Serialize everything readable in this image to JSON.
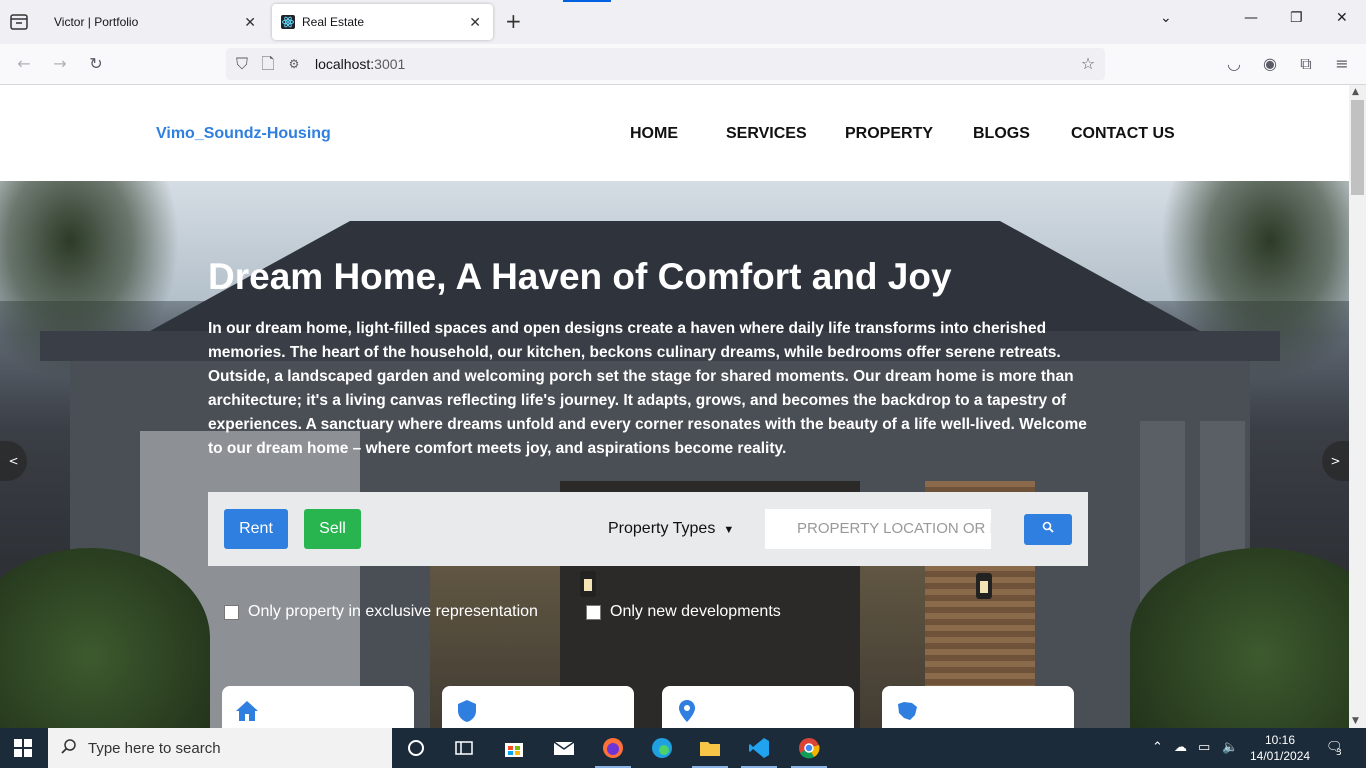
{
  "browser": {
    "tabs": [
      {
        "title": "Victor | Portfolio",
        "active": false
      },
      {
        "title": "Real Estate",
        "active": true
      }
    ],
    "url_host": "localhost:",
    "url_port": "3001"
  },
  "site": {
    "brand": "Vimo_Soundz-Housing",
    "menu": [
      "HOME",
      "SERVICES",
      "PROPERTY",
      "BLOGS",
      "CONTACT US"
    ]
  },
  "hero": {
    "title": "Dream Home, A Haven of Comfort and Joy",
    "text": "In our dream home, light-filled spaces and open designs create a haven where daily life transforms into cherished memories. The heart of the household, our kitchen, beckons culinary dreams, while bedrooms offer serene retreats. Outside, a landscaped garden and welcoming porch set the stage for shared moments. Our dream home is more than architecture; it's a living canvas reflecting life's journey. It adapts, grows, and becomes the backdrop to a tapestry of experiences. A sanctuary where dreams unfold and every corner resonates with the beauty of a life well-lived. Welcome to our dream home – where comfort meets joy, and aspirations become reality.",
    "prev_label": "<",
    "next_label": ">"
  },
  "search": {
    "rent_label": "Rent",
    "sell_label": "Sell",
    "property_types": "Property Types",
    "location_placeholder": "PROPERTY LOCATION OR I"
  },
  "filters": [
    "Only property in exclusive representation",
    "Only new developments"
  ],
  "taskbar": {
    "search_placeholder": "Type here to search",
    "time": "10:16",
    "date": "14/01/2024",
    "notifications": "3"
  },
  "colors": {
    "primary": "#2f7fe0",
    "sell": "#28b54f",
    "taskbar": "#1c2b3a"
  }
}
